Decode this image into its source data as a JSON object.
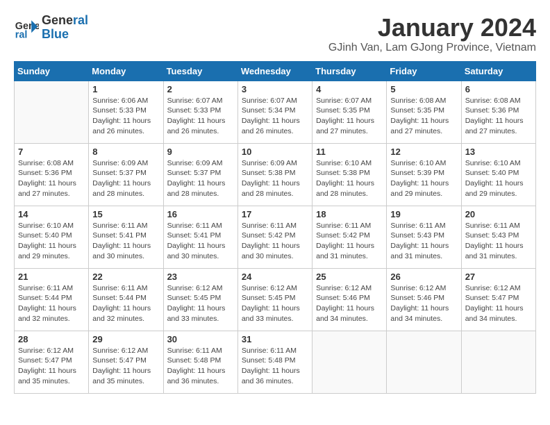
{
  "logo": {
    "text_general": "General",
    "text_blue": "Blue"
  },
  "calendar": {
    "title": "January 2024",
    "subtitle": "GJinh Van, Lam GJong Province, Vietnam",
    "days_of_week": [
      "Sunday",
      "Monday",
      "Tuesday",
      "Wednesday",
      "Thursday",
      "Friday",
      "Saturday"
    ],
    "weeks": [
      [
        {
          "day": "",
          "info": ""
        },
        {
          "day": "1",
          "info": "Sunrise: 6:06 AM\nSunset: 5:33 PM\nDaylight: 11 hours\nand 26 minutes."
        },
        {
          "day": "2",
          "info": "Sunrise: 6:07 AM\nSunset: 5:33 PM\nDaylight: 11 hours\nand 26 minutes."
        },
        {
          "day": "3",
          "info": "Sunrise: 6:07 AM\nSunset: 5:34 PM\nDaylight: 11 hours\nand 26 minutes."
        },
        {
          "day": "4",
          "info": "Sunrise: 6:07 AM\nSunset: 5:35 PM\nDaylight: 11 hours\nand 27 minutes."
        },
        {
          "day": "5",
          "info": "Sunrise: 6:08 AM\nSunset: 5:35 PM\nDaylight: 11 hours\nand 27 minutes."
        },
        {
          "day": "6",
          "info": "Sunrise: 6:08 AM\nSunset: 5:36 PM\nDaylight: 11 hours\nand 27 minutes."
        }
      ],
      [
        {
          "day": "7",
          "info": "Sunrise: 6:08 AM\nSunset: 5:36 PM\nDaylight: 11 hours\nand 27 minutes."
        },
        {
          "day": "8",
          "info": "Sunrise: 6:09 AM\nSunset: 5:37 PM\nDaylight: 11 hours\nand 28 minutes."
        },
        {
          "day": "9",
          "info": "Sunrise: 6:09 AM\nSunset: 5:37 PM\nDaylight: 11 hours\nand 28 minutes."
        },
        {
          "day": "10",
          "info": "Sunrise: 6:09 AM\nSunset: 5:38 PM\nDaylight: 11 hours\nand 28 minutes."
        },
        {
          "day": "11",
          "info": "Sunrise: 6:10 AM\nSunset: 5:38 PM\nDaylight: 11 hours\nand 28 minutes."
        },
        {
          "day": "12",
          "info": "Sunrise: 6:10 AM\nSunset: 5:39 PM\nDaylight: 11 hours\nand 29 minutes."
        },
        {
          "day": "13",
          "info": "Sunrise: 6:10 AM\nSunset: 5:40 PM\nDaylight: 11 hours\nand 29 minutes."
        }
      ],
      [
        {
          "day": "14",
          "info": "Sunrise: 6:10 AM\nSunset: 5:40 PM\nDaylight: 11 hours\nand 29 minutes."
        },
        {
          "day": "15",
          "info": "Sunrise: 6:11 AM\nSunset: 5:41 PM\nDaylight: 11 hours\nand 30 minutes."
        },
        {
          "day": "16",
          "info": "Sunrise: 6:11 AM\nSunset: 5:41 PM\nDaylight: 11 hours\nand 30 minutes."
        },
        {
          "day": "17",
          "info": "Sunrise: 6:11 AM\nSunset: 5:42 PM\nDaylight: 11 hours\nand 30 minutes."
        },
        {
          "day": "18",
          "info": "Sunrise: 6:11 AM\nSunset: 5:42 PM\nDaylight: 11 hours\nand 31 minutes."
        },
        {
          "day": "19",
          "info": "Sunrise: 6:11 AM\nSunset: 5:43 PM\nDaylight: 11 hours\nand 31 minutes."
        },
        {
          "day": "20",
          "info": "Sunrise: 6:11 AM\nSunset: 5:43 PM\nDaylight: 11 hours\nand 31 minutes."
        }
      ],
      [
        {
          "day": "21",
          "info": "Sunrise: 6:11 AM\nSunset: 5:44 PM\nDaylight: 11 hours\nand 32 minutes."
        },
        {
          "day": "22",
          "info": "Sunrise: 6:11 AM\nSunset: 5:44 PM\nDaylight: 11 hours\nand 32 minutes."
        },
        {
          "day": "23",
          "info": "Sunrise: 6:12 AM\nSunset: 5:45 PM\nDaylight: 11 hours\nand 33 minutes."
        },
        {
          "day": "24",
          "info": "Sunrise: 6:12 AM\nSunset: 5:45 PM\nDaylight: 11 hours\nand 33 minutes."
        },
        {
          "day": "25",
          "info": "Sunrise: 6:12 AM\nSunset: 5:46 PM\nDaylight: 11 hours\nand 34 minutes."
        },
        {
          "day": "26",
          "info": "Sunrise: 6:12 AM\nSunset: 5:46 PM\nDaylight: 11 hours\nand 34 minutes."
        },
        {
          "day": "27",
          "info": "Sunrise: 6:12 AM\nSunset: 5:47 PM\nDaylight: 11 hours\nand 34 minutes."
        }
      ],
      [
        {
          "day": "28",
          "info": "Sunrise: 6:12 AM\nSunset: 5:47 PM\nDaylight: 11 hours\nand 35 minutes."
        },
        {
          "day": "29",
          "info": "Sunrise: 6:12 AM\nSunset: 5:47 PM\nDaylight: 11 hours\nand 35 minutes."
        },
        {
          "day": "30",
          "info": "Sunrise: 6:11 AM\nSunset: 5:48 PM\nDaylight: 11 hours\nand 36 minutes."
        },
        {
          "day": "31",
          "info": "Sunrise: 6:11 AM\nSunset: 5:48 PM\nDaylight: 11 hours\nand 36 minutes."
        },
        {
          "day": "",
          "info": ""
        },
        {
          "day": "",
          "info": ""
        },
        {
          "day": "",
          "info": ""
        }
      ]
    ]
  }
}
